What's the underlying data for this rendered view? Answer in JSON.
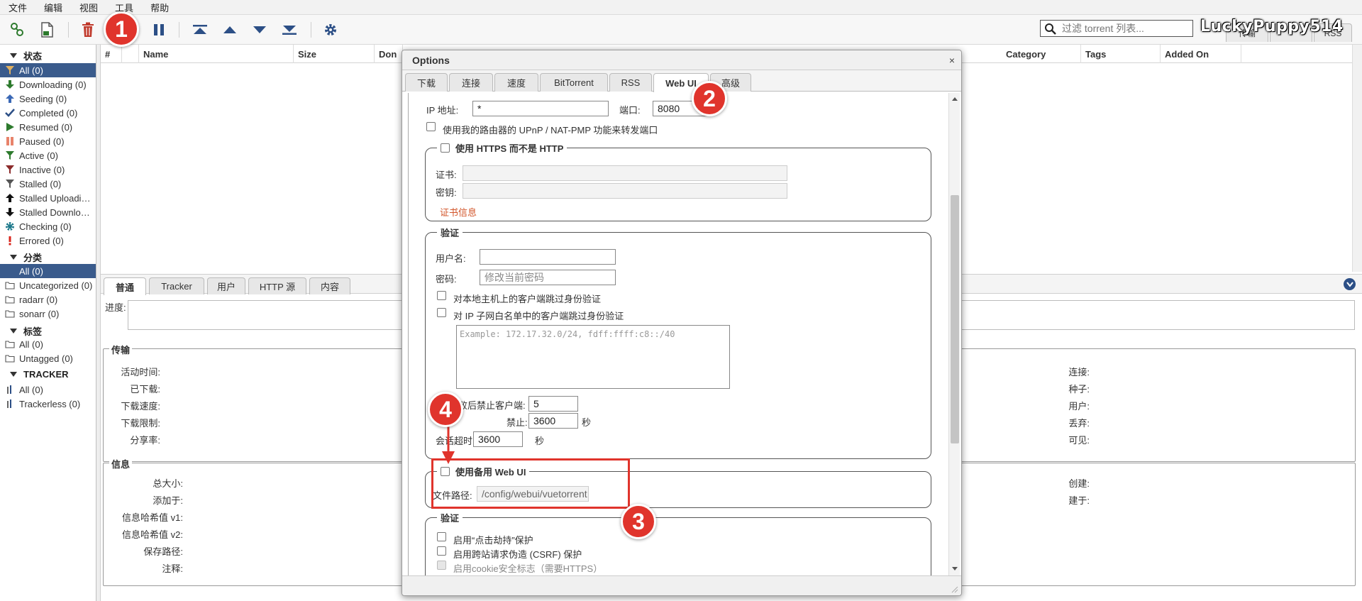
{
  "menu": [
    "文件",
    "编辑",
    "视图",
    "工具",
    "帮助"
  ],
  "filter": {
    "placeholder": "过滤 torrent 列表..."
  },
  "watermark": "LuckyPuppy514",
  "right_tabs": [
    "传输",
    "RSS"
  ],
  "sidebar": {
    "status_header": "状态",
    "status": [
      {
        "label": "All (0)",
        "icon": "filter-icon",
        "selected": true
      },
      {
        "label": "Downloading (0)",
        "icon": "download-arrow-icon"
      },
      {
        "label": "Seeding (0)",
        "icon": "upload-arrow-icon"
      },
      {
        "label": "Completed (0)",
        "icon": "checkmark-icon"
      },
      {
        "label": "Resumed (0)",
        "icon": "play-icon"
      },
      {
        "label": "Paused (0)",
        "icon": "pause-icon"
      },
      {
        "label": "Active (0)",
        "icon": "filter-icon"
      },
      {
        "label": "Inactive (0)",
        "icon": "filter-icon"
      },
      {
        "label": "Stalled (0)",
        "icon": "filter-icon"
      },
      {
        "label": "Stalled Uploadi…",
        "icon": "stalled-upload-icon"
      },
      {
        "label": "Stalled Downlo…",
        "icon": "stalled-download-icon"
      },
      {
        "label": "Checking (0)",
        "icon": "gear-icon"
      },
      {
        "label": "Errored (0)",
        "icon": "error-icon"
      }
    ],
    "category_header": "分类",
    "categories": [
      {
        "label": "All (0)",
        "selected": true
      },
      {
        "label": "Uncategorized (0)"
      },
      {
        "label": "radarr (0)"
      },
      {
        "label": "sonarr (0)"
      }
    ],
    "tags_header": "标签",
    "tags": [
      {
        "label": "All (0)"
      },
      {
        "label": "Untagged (0)"
      }
    ],
    "tracker_header": "TRACKER",
    "trackers": [
      {
        "label": "All (0)"
      },
      {
        "label": "Trackerless (0)"
      }
    ]
  },
  "table": {
    "columns": [
      "#",
      "",
      "Name",
      "Size",
      "Don",
      "Category",
      "Tags",
      "Added On"
    ]
  },
  "props": {
    "tabs": [
      "普通",
      "Tracker",
      "用户",
      "HTTP 源",
      "内容"
    ],
    "progress_label": "进度:",
    "transfer_title": "传输",
    "transfer_fields": [
      "活动时间:",
      "已下载:",
      "下载速度:",
      "下载限制:",
      "分享率:"
    ],
    "transfer_right_fields": [
      "连接:",
      "种子:",
      "用户:",
      "丢弃:",
      "可见:"
    ],
    "info_title": "信息",
    "info_fields": [
      "总大小:",
      "添加于:",
      "信息哈希值 v1:",
      "信息哈希值 v2:",
      "保存路径:",
      "注释:"
    ],
    "info_right_fields": [
      "创建:",
      "建于:"
    ]
  },
  "dialog": {
    "title": "Options",
    "close": "×",
    "tabs": [
      "下载",
      "连接",
      "速度",
      "BitTorrent",
      "RSS",
      "Web UI",
      "高级"
    ],
    "active_tab": "Web UI",
    "ip_label": "IP 地址:",
    "ip_value": "*",
    "port_label": "端口:",
    "port_value": "8080",
    "upnp_label": "使用我的路由器的 UPnP / NAT-PMP 功能来转发端口",
    "https_legend": "使用 HTTPS 而不是 HTTP",
    "cert_label": "证书:",
    "key_label": "密钥:",
    "cert_info": "证书信息",
    "auth_legend": "验证",
    "username_label": "用户名:",
    "password_label": "密码:",
    "password_placeholder": "修改当前密码",
    "bypass_local": "对本地主机上的客户端跳过身份验证",
    "bypass_whitelist": "对 IP 子网白名单中的客户端跳过身份验证",
    "whitelist_placeholder": "Example: 172.17.32.0/24, fdff:ffff:c8::/40",
    "ban_label": "败后禁止客户端:",
    "ban_value": "5",
    "ban_time_label": "禁止:",
    "ban_time_value": "3600",
    "ban_time_unit": "秒",
    "session_label": "会话超时:",
    "session_value": "3600",
    "session_unit": "秒",
    "alt_webui_legend": "使用备用 Web UI",
    "file_path_label": "文件路径:",
    "file_path_value": "/config/webui/vuetorrent",
    "security_legend": "验证",
    "clickjacking": "启用“点击劫持”保护",
    "csrf": "启用跨站请求伪造 (CSRF) 保护",
    "cookie_secure": "启用cookie安全标志（需要HTTPS）"
  },
  "annotations": [
    "1",
    "2",
    "3",
    "4"
  ],
  "colors": {
    "accent": "#e0342c",
    "selected": "#3a5b8c"
  }
}
